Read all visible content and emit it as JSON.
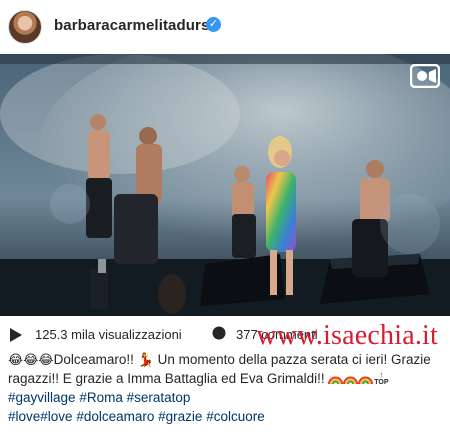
{
  "header": {
    "username": "barbaracarmelitadurso",
    "verified_symbol": "✓",
    "avatar_icon": "profile-avatar"
  },
  "video": {
    "icon": "video-camera-icon"
  },
  "stats": {
    "play_icon": "play-icon",
    "views_text": "125.3 mila visualizzazioni",
    "comment_icon": "comment-icon",
    "comments_text": "377 commenti"
  },
  "watermark": "www.isaechia.it",
  "caption": {
    "part1": "Dolceamaro!!",
    "part2": " Un momento della pazza serata ci ieri! Grazie ragazzi!! E grazie a Imma Battaglia ed Eva Grimaldi!! ",
    "tags_line1": [
      "#gayvillage",
      "#Roma",
      "#seratatop"
    ],
    "tags_line2": [
      "#love",
      "#love",
      "#dolceamaro",
      "#grazie",
      "#colcuore"
    ],
    "emoji_laugh": "😂",
    "emoji_dancer": "💃",
    "top_label": "TOP"
  },
  "colors": {
    "link": "#003569",
    "watermark": "#d71d32",
    "verified": "#3897f0"
  }
}
